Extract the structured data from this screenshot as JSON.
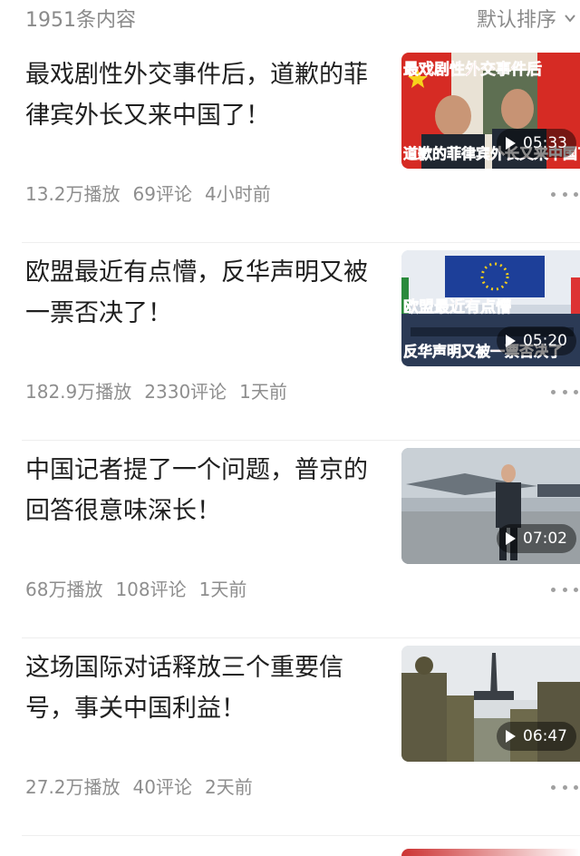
{
  "header": {
    "count_label": "1951条内容",
    "sort_label": "默认排序",
    "sort_icon": "chevron-down-icon"
  },
  "items": [
    {
      "title": "最戏剧性外交事件后，道歉的菲律宾外长又来中国了！",
      "views": "13.2万播放",
      "comments": "69评论",
      "time": "4小时前",
      "duration": "05:33",
      "overlay_top": "最戏剧性外交事件后",
      "overlay_bottom": "道歉的菲律宾外长又来中国了"
    },
    {
      "title": "欧盟最近有点懵，反华声明又被一票否决了！",
      "views": "182.9万播放",
      "comments": "2330评论",
      "time": "1天前",
      "duration": "05:20",
      "overlay_top": "欧盟最近有点懵",
      "overlay_bottom": "反华声明又被一票否决了"
    },
    {
      "title": "中国记者提了一个问题，普京的回答很意味深长！",
      "views": "68万播放",
      "comments": "108评论",
      "time": "1天前",
      "duration": "07:02"
    },
    {
      "title": "这场国际对话释放三个重要信号，事关中国利益！",
      "views": "27.2万播放",
      "comments": "40评论",
      "time": "2天前",
      "duration": "06:47"
    }
  ],
  "colors": {
    "meta_text": "#8e8e8e",
    "title_text": "#1f1f1f",
    "overlay_red": "#e62a2a"
  }
}
